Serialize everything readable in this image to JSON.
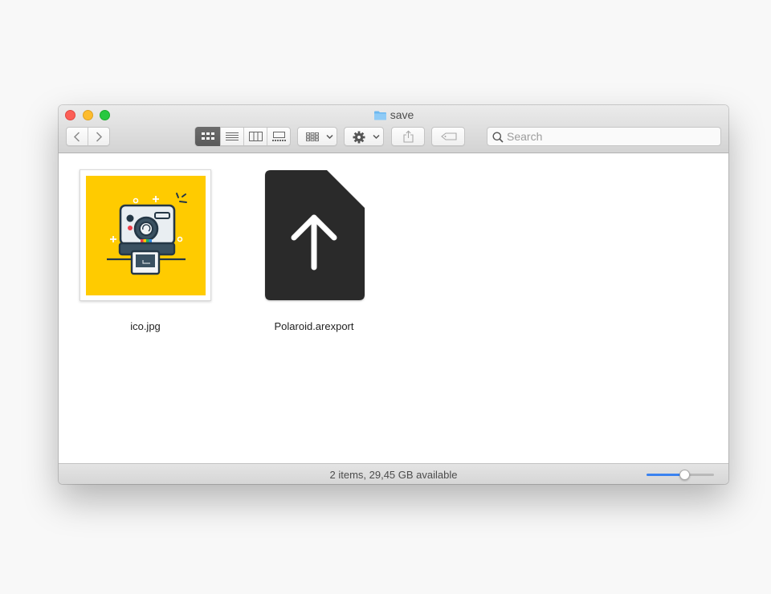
{
  "window": {
    "title": "save",
    "title_icon": "folder-icon"
  },
  "toolbar": {
    "back": "chevron-left-icon",
    "forward": "chevron-right-icon",
    "view_modes": [
      "icon-view-icon",
      "list-view-icon",
      "column-view-icon",
      "gallery-view-icon"
    ],
    "active_view": "icon",
    "group_by": "group-by-icon",
    "action": "gear-icon",
    "share": "share-icon",
    "tags": "tag-icon"
  },
  "search": {
    "placeholder": "Search",
    "value": ""
  },
  "files": [
    {
      "name": "ico.jpg",
      "kind": "image-thumbnail"
    },
    {
      "name": "Polaroid.arexport",
      "kind": "document-upload-icon"
    }
  ],
  "status": {
    "text": "2 items, 29,45 GB available"
  },
  "zoom": {
    "level": 0.57
  },
  "colors": {
    "accent": "#3b83f0",
    "thumbnail_background": "#ffcb00",
    "document_icon": "#2a2a2a",
    "close": "#fc5f57",
    "minimize": "#fdbc2e",
    "maximize": "#28c840"
  }
}
